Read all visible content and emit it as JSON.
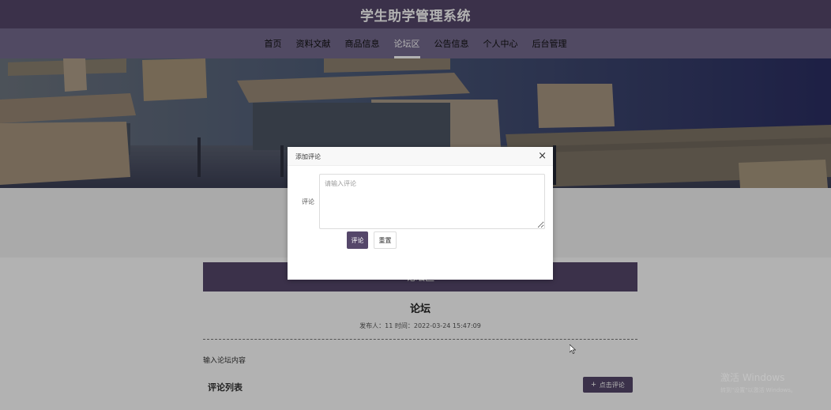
{
  "header": {
    "site_title": "学生助学管理系统"
  },
  "nav": {
    "items": [
      {
        "label": "首页"
      },
      {
        "label": "资料文献"
      },
      {
        "label": "商品信息"
      },
      {
        "label": "论坛区"
      },
      {
        "label": "公告信息"
      },
      {
        "label": "个人中心"
      },
      {
        "label": "后台管理"
      }
    ],
    "active_label": "论坛区"
  },
  "section": {
    "header": "论坛区"
  },
  "forum": {
    "title": "论坛",
    "meta": "发布人：11 时间：2022-03-24 15:47:09",
    "content": "输入论坛内容"
  },
  "comments": {
    "list_title": "评论列表",
    "add_label": "点击评论",
    "add_icon": "plus-icon"
  },
  "modal": {
    "title": "添加评论",
    "close_icon": "close-icon",
    "field_label": "评论",
    "placeholder": "请输入评论",
    "value": "",
    "submit_label": "评论",
    "reset_label": "重置"
  },
  "watermark": {
    "line1": "激活 Windows",
    "line2": "转到\"设置\"以激活 Windows。"
  },
  "colors": {
    "primary": "#55476a",
    "nav_bg": "#756b8e",
    "overlay": "rgba(0,0,0,0.3)"
  }
}
